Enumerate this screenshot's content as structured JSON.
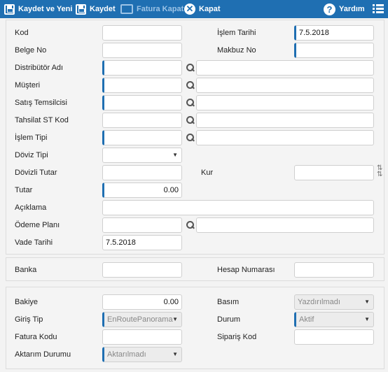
{
  "toolbar": {
    "save_and_new": "Kaydet ve Yeni",
    "save": "Kaydet",
    "close_invoice": "Fatura Kapat",
    "close": "Kapat",
    "help": "Yardım"
  },
  "form": {
    "kod_label": "Kod",
    "kod_value": "",
    "islem_tarihi_label": "İşlem Tarihi",
    "islem_tarihi_value": "7.5.2018",
    "belge_no_label": "Belge No",
    "makbuz_no_label": "Makbuz No",
    "distributor_label": "Distribütör Adı",
    "musteri_label": "Müşteri",
    "satis_temsilcisi_label": "Satış Temsilcisi",
    "tahsilat_st_kod_label": "Tahsilat ST Kod",
    "islem_tipi_label": "İşlem Tipi",
    "doviz_tipi_label": "Döviz Tipi",
    "dovizli_tutar_label": "Dövizli Tutar",
    "kur_label": "Kur",
    "tutar_label": "Tutar",
    "tutar_value": "0.00",
    "aciklama_label": "Açıklama",
    "odeme_plani_label": "Ödeme Planı",
    "vade_tarihi_label": "Vade Tarihi",
    "vade_tarihi_value": "7.5.2018"
  },
  "bank": {
    "banka_label": "Banka",
    "hesap_numarasi_label": "Hesap Numarası"
  },
  "extra": {
    "bakiye_label": "Bakiye",
    "bakiye_value": "0.00",
    "basim_label": "Basım",
    "basim_value": "Yazdırılmadı",
    "giris_tip_label": "Giriş Tip",
    "giris_tip_value": "EnRoutePanorama",
    "durum_label": "Durum",
    "durum_value": "Aktif",
    "fatura_kodu_label": "Fatura Kodu",
    "siparis_kod_label": "Sipariş Kod",
    "aktarim_durumu_label": "Aktarım Durumu",
    "aktarim_durumu_value": "Aktarılmadı"
  },
  "colors": {
    "toolbar_bg": "#1f6fb2",
    "required_accent": "#1f6fb2"
  }
}
